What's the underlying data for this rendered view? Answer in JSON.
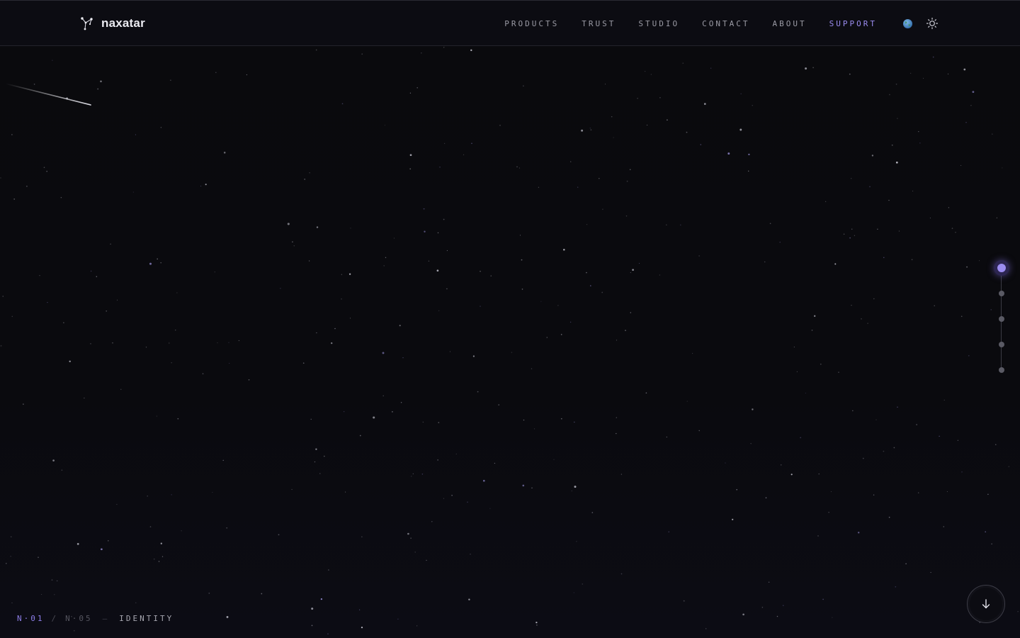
{
  "brand": {
    "name": "naxatar",
    "icon": "constellation-icon"
  },
  "nav": {
    "items": [
      {
        "label": "PRODUCTS",
        "active": false
      },
      {
        "label": "TRUST",
        "active": false
      },
      {
        "label": "STUDIO",
        "active": false
      },
      {
        "label": "CONTACT",
        "active": false
      },
      {
        "label": "ABOUT",
        "active": false
      },
      {
        "label": "SUPPORT",
        "active": true
      }
    ],
    "globe_icon": "globe-icon",
    "theme_icon": "sun-icon"
  },
  "section_rail": {
    "count": 5,
    "active_index": 0
  },
  "footer": {
    "current": "N·01",
    "separator": "/",
    "total": "N·05",
    "dash": "—",
    "section_name": "IDENTITY"
  },
  "scroll_button": {
    "icon": "arrow-down-icon"
  },
  "colors": {
    "accent": "#9b8cf0",
    "background": "#0a0a0e",
    "header": "#0c0c12",
    "nav_text": "#9a9aa4"
  }
}
